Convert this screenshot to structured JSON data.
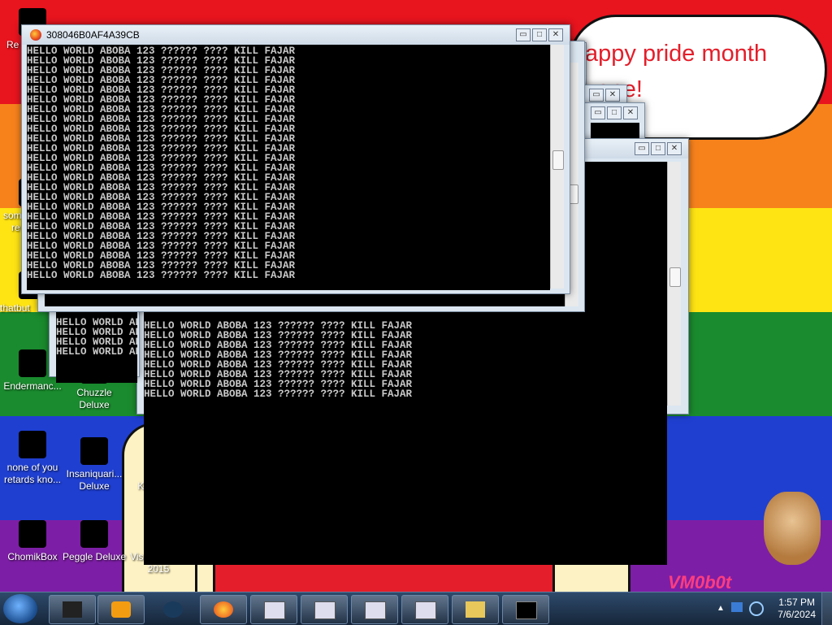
{
  "wallpaper": {
    "speech_bubble": "appy pride month\nyone!",
    "watermark": "VM0b0t"
  },
  "desktop_icons": [
    {
      "label": "Re"
    },
    {
      "label": "some"
    },
    {
      "label": "re"
    },
    {
      "label": "thatbut"
    },
    {
      "label": "Endermanc..."
    },
    {
      "label": "Chuzzle Deluxe"
    },
    {
      "label": "none of you retards kno..."
    },
    {
      "label": "Insaniquari... Deluxe"
    },
    {
      "label": "VMO KevinSt..."
    },
    {
      "label": "ChomikBox"
    },
    {
      "label": "Peggle Deluxe"
    },
    {
      "label": "Visual Studio 2015"
    }
  ],
  "console_line": "HELLO WORLD ABOBA 123 ?????? ???? KILL FAJAR",
  "main_window": {
    "title": "308046B0AF4A39CB"
  },
  "window_controls": {
    "minimize": "▭",
    "maximize": "□",
    "close": "✕"
  },
  "taskbar": {
    "time": "1:57 PM",
    "date": "7/6/2024"
  }
}
